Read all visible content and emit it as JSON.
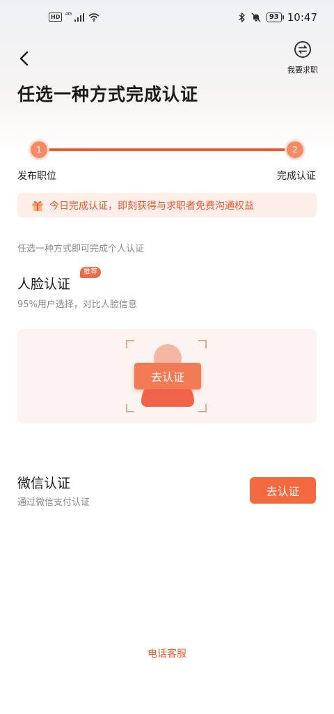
{
  "status_bar": {
    "hd": "HD",
    "network": "4G",
    "battery": "93",
    "time": "10:47"
  },
  "header": {
    "switch_label": "我要求职",
    "title": "任选一种方式完成认证"
  },
  "progress": {
    "steps": [
      {
        "number": "1",
        "label": "发布职位"
      },
      {
        "number": "2",
        "label": "完成认证"
      }
    ]
  },
  "banner": {
    "text": "今日完成认证，即刻获得与求职者免费沟通权益"
  },
  "hint": "任选一种方式即可完成个人认证",
  "face": {
    "title": "人脸认证",
    "badge": "推荐",
    "subtitle": "95%用户选择，对比人脸信息",
    "button": "去认证"
  },
  "wechat": {
    "title": "微信认证",
    "subtitle": "通过微信支付认证",
    "button": "去认证"
  },
  "footer": {
    "service": "电话客服"
  },
  "colors": {
    "accent": "#f0582f",
    "button": "#f2693f",
    "banner_bg": "#fdeeea",
    "card_bg": "#fdf3f0"
  }
}
